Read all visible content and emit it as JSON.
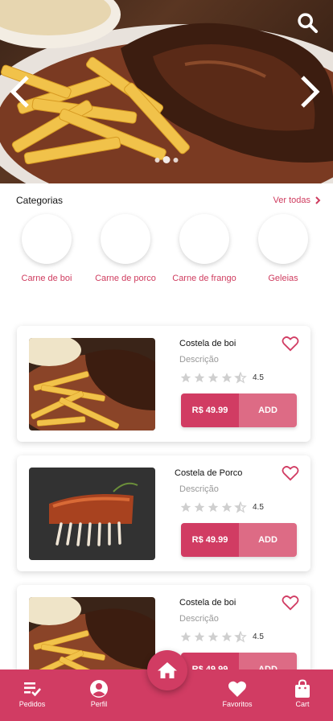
{
  "hero": {
    "search_icon": "search-icon",
    "prev_icon": "chevron-left-icon",
    "next_icon": "chevron-right-icon",
    "slides": 3,
    "active_slide": 2
  },
  "categories": {
    "title": "Categorias",
    "see_all": "Ver todas",
    "items": [
      {
        "label": "Carne de boi"
      },
      {
        "label": "Carne de porco"
      },
      {
        "label": "Carne de frango"
      },
      {
        "label": "Geleias"
      }
    ]
  },
  "products": [
    {
      "name": "Costela de boi",
      "description": "Descrição",
      "rating": "4.5",
      "price": "R$ 49.99",
      "add_label": "ADD"
    },
    {
      "name": "Costela de Porco",
      "description": "Descrição",
      "rating": "4.5",
      "price": "R$ 49.99",
      "add_label": "ADD"
    },
    {
      "name": "Costela de boi",
      "description": "Descrição",
      "rating": "4.5",
      "price": "R$ 49.99",
      "add_label": "ADD"
    }
  ],
  "nav": {
    "orders": "Pedidos",
    "profile": "Perfil",
    "favorites": "Favoritos",
    "cart": "Cart",
    "home_icon": "home-icon"
  },
  "colors": {
    "brand": "#d13c63",
    "brand_light": "#dd6b85"
  }
}
